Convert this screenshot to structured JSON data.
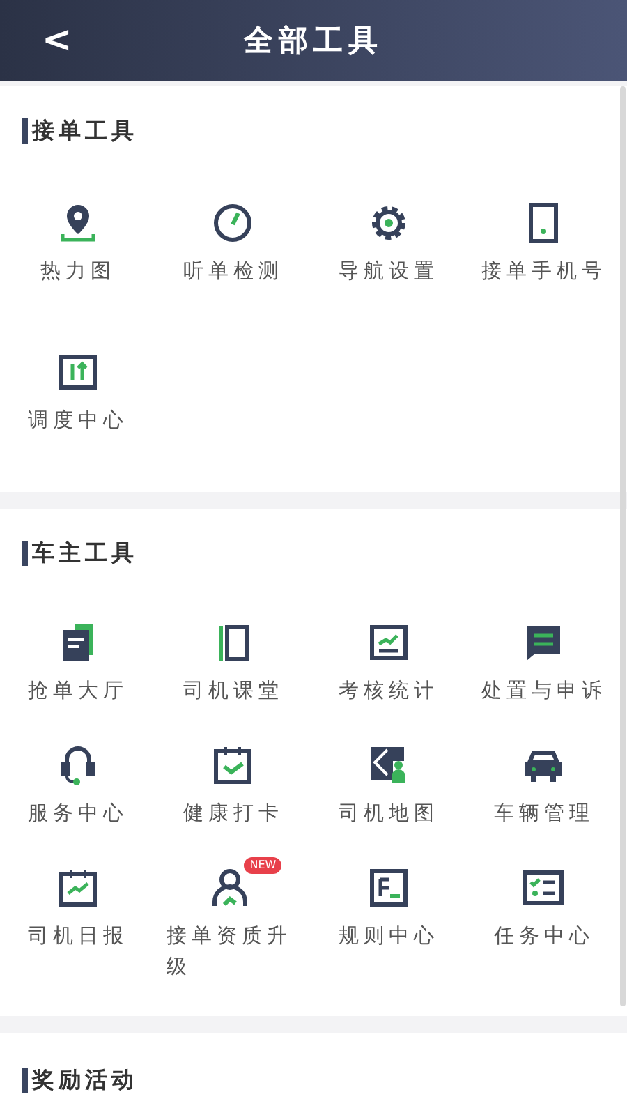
{
  "header": {
    "back": "<",
    "title": "全部工具"
  },
  "sections": [
    {
      "title": "接单工具",
      "items": [
        {
          "label": "热力图"
        },
        {
          "label": "听单检测"
        },
        {
          "label": "导航设置"
        },
        {
          "label": "接单手机号"
        },
        {
          "label": "调度中心"
        }
      ]
    },
    {
      "title": "车主工具",
      "items": [
        {
          "label": "抢单大厅"
        },
        {
          "label": "司机课堂"
        },
        {
          "label": "考核统计"
        },
        {
          "label": "处置与申诉"
        },
        {
          "label": "服务中心"
        },
        {
          "label": "健康打卡"
        },
        {
          "label": "司机地图"
        },
        {
          "label": "车辆管理"
        },
        {
          "label": "司机日报"
        },
        {
          "label": "接单资质升级",
          "badge": "NEW"
        },
        {
          "label": "规则中心"
        },
        {
          "label": "任务中心"
        }
      ]
    },
    {
      "title": "奖励活动"
    }
  ]
}
